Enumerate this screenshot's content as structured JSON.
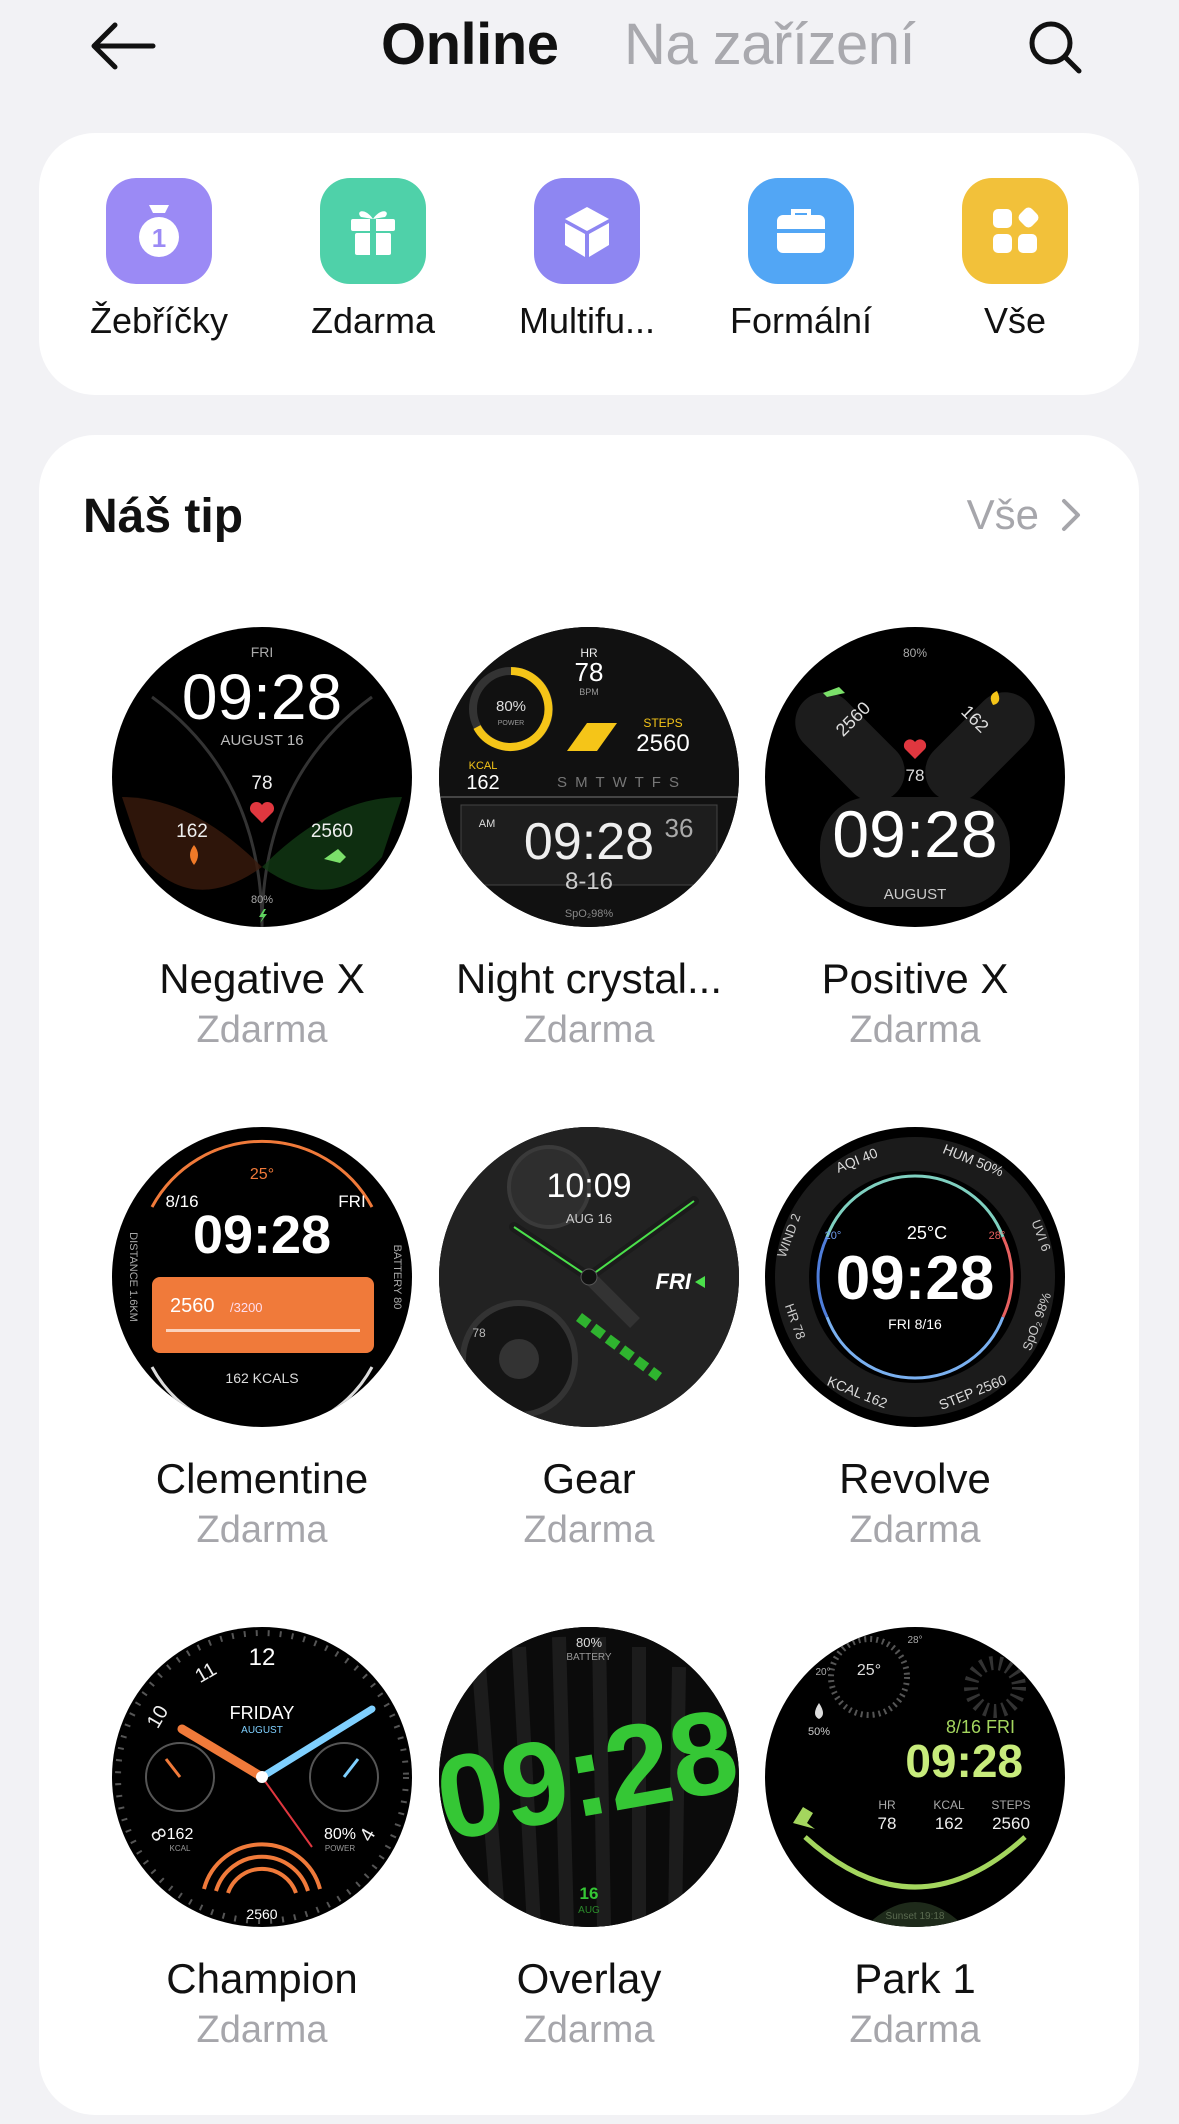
{
  "header": {
    "tab_online": "Online",
    "tab_device": "Na zařízení",
    "back_icon": "arrow-left-icon",
    "search_icon": "search-icon"
  },
  "categories": [
    {
      "label": "Žebříčky",
      "icon": "trophy-icon",
      "color": "#9b8af5"
    },
    {
      "label": "Zdarma",
      "icon": "gift-icon",
      "color": "#4fd1a9"
    },
    {
      "label": "Multifu...",
      "icon": "cube-icon",
      "color": "#8e86f2"
    },
    {
      "label": "Formální",
      "icon": "briefcase-icon",
      "color": "#52a6f5"
    },
    {
      "label": "Vše",
      "icon": "grid-icon",
      "color": "#f2c13a"
    }
  ],
  "tips": {
    "title": "Náš tip",
    "see_all": "Vše",
    "faces": [
      {
        "name": "Negative X",
        "price": "Zdarma",
        "texts": {
          "day": "FRI",
          "time": "09:28",
          "date": "AUGUST 16",
          "hr": "78",
          "kcal": "162",
          "steps": "2560",
          "battery": "80%"
        }
      },
      {
        "name": "Night crystal...",
        "price": "Zdarma",
        "texts": {
          "hr_label": "HR",
          "hr": "78",
          "bpm": "BPM",
          "power": "80%",
          "power_label": "POWER",
          "kcal_label": "KCAL",
          "kcal": "162",
          "steps_label": "STEPS",
          "steps": "2560",
          "days": "S M T W T F S",
          "am": "AM",
          "time": "09:28",
          "sec": "36",
          "date": "8-16",
          "spo2": "SpO₂98%"
        }
      },
      {
        "name": "Positive X",
        "price": "Zdarma",
        "texts": {
          "battery": "80%",
          "steps": "2560",
          "kcal": "162",
          "hr": "78",
          "time": "09:28",
          "month": "AUGUST"
        }
      },
      {
        "name": "Clementine",
        "price": "Zdarma",
        "texts": {
          "temp": "25°",
          "date": "8/16",
          "day": "FRI",
          "time": "09:28",
          "steps": "2560",
          "goal": "/3200",
          "kcal": "162 KCALS",
          "distance": "DISTANCE 1.6KM",
          "battery": "BATTERY 80"
        }
      },
      {
        "name": "Gear",
        "price": "Zdarma",
        "texts": {
          "time": "10:09",
          "date": "AUG 16",
          "day": "FRI",
          "hr": "78"
        }
      },
      {
        "name": "Revolve",
        "price": "Zdarma",
        "texts": {
          "aqi": "AQI 40",
          "hum": "HUM 50%",
          "wind": "WIND 2",
          "uvi": "UVI 6",
          "hr": "HR 78",
          "spo2": "SpO₂ 98%",
          "kcal": "KCAL 162",
          "step": "STEP 2560",
          "temp": "25°C",
          "low": "20°",
          "high": "28°",
          "time": "09:28",
          "date": "FRI 8/16"
        }
      },
      {
        "name": "Champion",
        "price": "Zdarma",
        "texts": {
          "n12": "12",
          "n10": "10",
          "n11": "11",
          "n8": "8",
          "n4": "4",
          "day": "FRIDAY",
          "month": "AUGUST",
          "kcal": "162",
          "kcal_label": "KCAL",
          "bat": "80%",
          "bat_label": "POWER",
          "steps": "2560"
        }
      },
      {
        "name": "Overlay",
        "price": "Zdarma",
        "texts": {
          "battery": "80%",
          "battery_label": "BATTERY",
          "time": "09:28",
          "date": "16",
          "month": "AUG"
        }
      },
      {
        "name": "Park 1",
        "price": "Zdarma",
        "texts": {
          "temp": "25°",
          "t28": "28°",
          "t20": "20°",
          "hum": "50%",
          "date": "8/16 FRI",
          "time": "09:28",
          "hr_label": "HR",
          "kcal_label": "KCAL",
          "steps_label": "STEPS",
          "hr": "78",
          "kcal": "162",
          "steps": "2560",
          "sunset": "Sunset 19:18"
        }
      }
    ]
  }
}
